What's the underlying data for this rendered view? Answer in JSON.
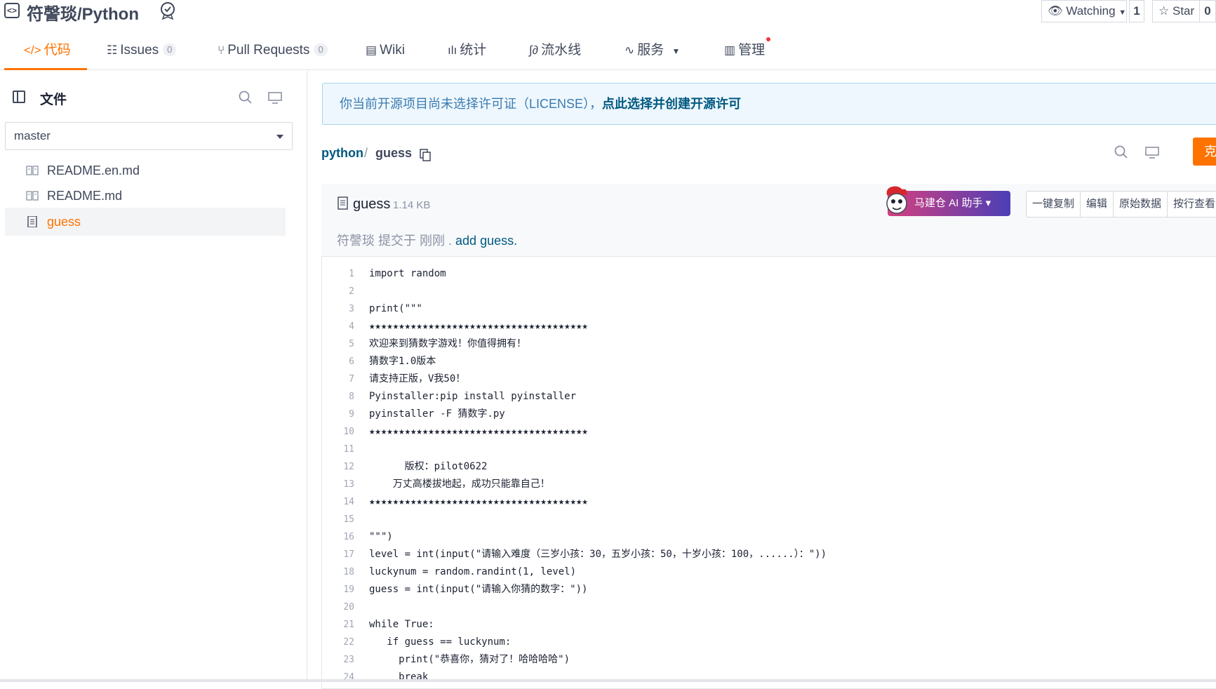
{
  "repo": {
    "title": "符謦琰/Python"
  },
  "header": {
    "watch_label": "Watching",
    "watch_count": "1",
    "star_label": "Star",
    "star_count": "0"
  },
  "tabs": [
    {
      "label": "代码",
      "count": null
    },
    {
      "label": "Issues",
      "count": "0"
    },
    {
      "label": "Pull Requests",
      "count": "0"
    },
    {
      "label": "Wiki",
      "count": null
    },
    {
      "label": "统计",
      "count": null
    },
    {
      "label": "流水线",
      "count": null
    },
    {
      "label": "服务",
      "count": null
    },
    {
      "label": "管理",
      "count": null
    }
  ],
  "sidebar": {
    "title": "文件",
    "branch": "master",
    "files": [
      {
        "name": "README.en.md"
      },
      {
        "name": "README.md"
      },
      {
        "name": "guess"
      }
    ]
  },
  "license": {
    "text": "你当前开源项目尚未选择许可证（LICENSE），",
    "link": "点此选择并创建开源许可"
  },
  "breadcrumb": {
    "repo": "python",
    "sep": "/",
    "file": "guess"
  },
  "clone_label": "克",
  "file": {
    "name": "guess",
    "size": "1.14 KB",
    "commit_prefix": "符謦琰 提交于 刚刚 .",
    "commit_msg": "add guess.",
    "ai_label": "马建仓 AI 助手 ▾",
    "actions": [
      "一键复制",
      "编辑",
      "原始数据",
      "按行查看"
    ]
  },
  "code_lines": [
    "import random",
    "",
    "print(\"\"\"",
    "★★★★★★★★★★★★★★★★★★★★★★★★★★★★★★★★★★★★★",
    "欢迎来到猜数字游戏！你值得拥有！",
    "猜数字1.0版本",
    "请支持正版，V我50！",
    "Pyinstaller:pip install pyinstaller",
    "pyinstaller -F 猜数字.py",
    "★★★★★★★★★★★★★★★★★★★★★★★★★★★★★★★★★★★★★",
    "",
    "      版权：pilot0622",
    "    万丈高楼拔地起，成功只能靠自己！",
    "★★★★★★★★★★★★★★★★★★★★★★★★★★★★★★★★★★★★★",
    "",
    "\"\"\")",
    "level = int(input(\"请输入难度（三岁小孩：30，五岁小孩：50，十岁小孩：100，......）：\"))",
    "luckynum = random.randint(1, level)",
    "guess = int(input(\"请输入你猜的数字：\"))",
    "",
    "while True:",
    "   if guess == luckynum:",
    "     print(\"恭喜你，猜对了！哈哈哈哈\")",
    "     break"
  ],
  "colors": {
    "accent": "#fe7300",
    "link": "#005980",
    "license_bg": "#eef7fd"
  }
}
